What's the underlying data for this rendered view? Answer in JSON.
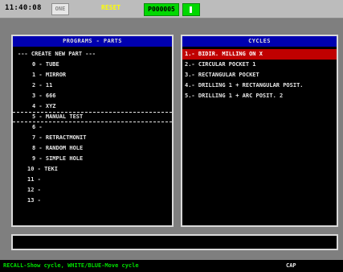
{
  "topbar": {
    "time": "11:40:08",
    "mode": "ONE",
    "reset": "RESET",
    "program": "P000005"
  },
  "programs": {
    "title": "PROGRAMS - PARTS",
    "items": [
      "--- CREATE NEW PART ---",
      "0 - TUBE",
      "1 - MIRROR",
      "2 - 11",
      "3 - 666",
      "4 - XYZ",
      "5 - MANUAL TEST",
      "6 -",
      "7 - RETRACTMONIT",
      "8 - RANDOM HOLE",
      "9 - SIMPLE HOLE",
      "10 - TEKI",
      "11 -",
      "12 -",
      "13 -"
    ]
  },
  "cycles": {
    "title": "CYCLES",
    "items": [
      "1.- BIDIR. MILLING ON X",
      "2.- CIRCULAR POCKET 1",
      "3.- RECTANGULAR POCKET",
      "4.- DRILLING 1 + RECTANGULAR POSIT.",
      "5.- DRILLING 1 + ARC POSIT. 2"
    ]
  },
  "status": {
    "text": "RECALL-Show cycle, WHITE/BLUE-Move cycle",
    "caps": "CAP"
  },
  "colors": {
    "background": "#7f7f7f",
    "panel_header": "#0000b0",
    "active_row": "#c00000",
    "status_green": "#00e000",
    "program_green": "#00d800"
  }
}
